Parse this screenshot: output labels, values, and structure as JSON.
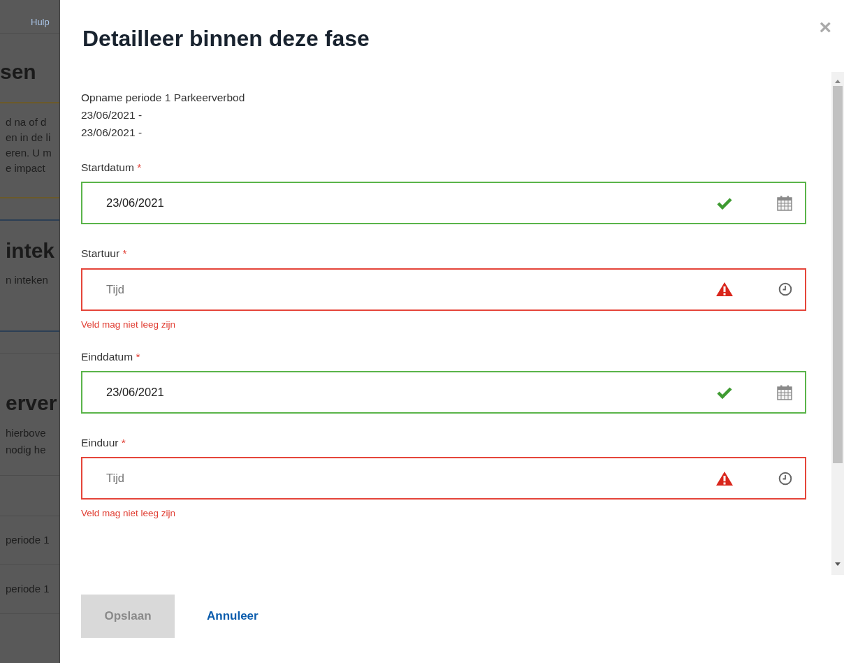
{
  "background_page": {
    "help_link": "Hulp",
    "heading_1": "sen",
    "notice_lines": [
      "d na of d",
      "en in de li",
      "eren. U m",
      "e impact"
    ],
    "heading_2": "intek",
    "text_2": "n inteken",
    "heading_3": "erver",
    "text_3_lines": [
      "hierbove",
      "nodig he"
    ],
    "list_rows": [
      "periode 1",
      "periode 1"
    ]
  },
  "dialog": {
    "title": "Detailleer binnen deze fase",
    "close": "×",
    "summary_lines": [
      "Opname periode 1 Parkeerverbod",
      "23/06/2021 -",
      "23/06/2021 -"
    ],
    "fields": [
      {
        "label": "Startdatum",
        "required_mark": "*",
        "kind": "date",
        "value": "23/06/2021",
        "valid": true
      },
      {
        "label": "Startuur",
        "required_mark": "*",
        "kind": "time",
        "placeholder": "Tijd",
        "valid": false,
        "error": "Veld mag niet leeg zijn"
      },
      {
        "label": "Einddatum",
        "required_mark": "*",
        "kind": "date",
        "value": "23/06/2021",
        "valid": true
      },
      {
        "label": "Einduur",
        "required_mark": "*",
        "kind": "time",
        "placeholder": "Tijd",
        "valid": false,
        "error": "Veld mag niet leeg zijn"
      }
    ],
    "save_button": {
      "label": "Opslaan",
      "disabled": true
    },
    "cancel_link": "Annuleer"
  }
}
